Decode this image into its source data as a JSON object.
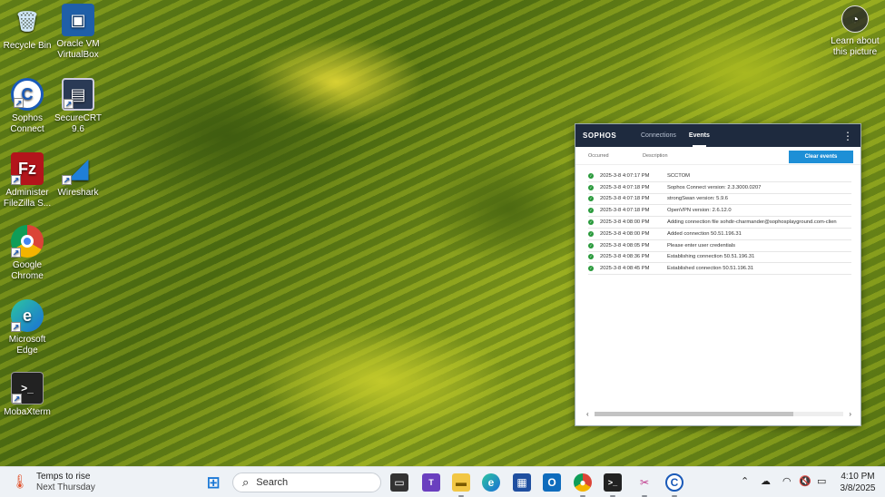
{
  "desktop": {
    "icons": [
      {
        "label": "Recycle Bin",
        "glyph": "🗑"
      },
      {
        "label": "Oracle VM VirtualBox",
        "glyph": "▣"
      },
      {
        "label": "Sophos Connect",
        "glyph": "C"
      },
      {
        "label": "SecureCRT 9.6",
        "glyph": "▤"
      },
      {
        "label": "Administer FileZilla S...",
        "glyph": "Fz"
      },
      {
        "label": "Wireshark",
        "glyph": "◢"
      },
      {
        "label": "Google Chrome",
        "glyph": "●"
      },
      {
        "label": "Microsoft Edge",
        "glyph": "e"
      },
      {
        "label": "MobaXterm",
        "glyph": ">_"
      }
    ],
    "learn_label": "Learn about this picture"
  },
  "sophos": {
    "brand": "SOPHOS",
    "tabs": [
      "Connections",
      "Events"
    ],
    "active_tab": "Events",
    "columns": [
      "Occurred",
      "Description"
    ],
    "clear_label": "Clear events",
    "events": [
      {
        "time": "2025-3-8 4:07:17 PM",
        "desc": "SCCTOM"
      },
      {
        "time": "2025-3-8 4:07:18 PM",
        "desc": "Sophos Connect version: 2.3.3000.0207"
      },
      {
        "time": "2025-3-8 4:07:18 PM",
        "desc": "strongSwan version: 5.9.6"
      },
      {
        "time": "2025-3-8 4:07:18 PM",
        "desc": "OpenVPN version: 2.6.12.0"
      },
      {
        "time": "2025-3-8 4:08:00 PM",
        "desc": "Adding connection file sohdir-charmander@sophosplayground.com-clien"
      },
      {
        "time": "2025-3-8 4:08:00 PM",
        "desc": "Added connection 50.51.196.31"
      },
      {
        "time": "2025-3-8 4:08:05 PM",
        "desc": "Please enter user credentials"
      },
      {
        "time": "2025-3-8 4:08:36 PM",
        "desc": "Establishing connection 50.51.196.31"
      },
      {
        "time": "2025-3-8 4:08:45 PM",
        "desc": "Established connection 50.51.196.31"
      }
    ]
  },
  "taskbar": {
    "weather_line1": "Temps to rise",
    "weather_line2": "Next Thursday",
    "search_placeholder": "Search",
    "time": "4:10 PM",
    "date": "3/8/2025"
  },
  "colors": {
    "sophos_header": "#1e2a3e",
    "accent_blue": "#1e8fd6",
    "status_green": "#2a9a3c"
  }
}
